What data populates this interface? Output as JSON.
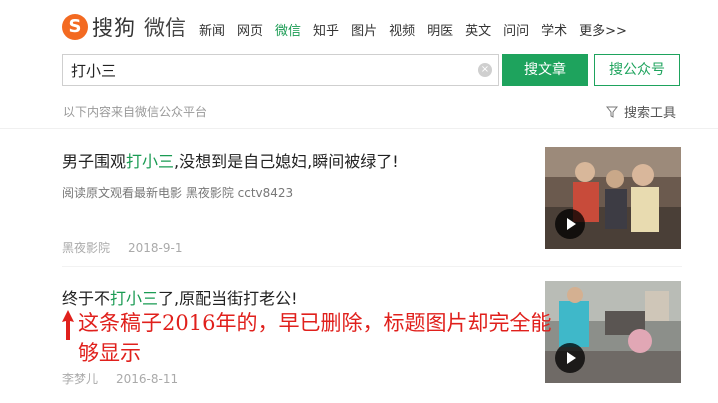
{
  "header": {
    "logo_mark": "S",
    "logo_text": "搜狗",
    "logo_sub": "微信",
    "nav": [
      {
        "label": "新闻",
        "active": false
      },
      {
        "label": "网页",
        "active": false
      },
      {
        "label": "微信",
        "active": true
      },
      {
        "label": "知乎",
        "active": false
      },
      {
        "label": "图片",
        "active": false
      },
      {
        "label": "视频",
        "active": false
      },
      {
        "label": "明医",
        "active": false
      },
      {
        "label": "英文",
        "active": false
      },
      {
        "label": "问问",
        "active": false
      },
      {
        "label": "学术",
        "active": false
      },
      {
        "label": "更多>>",
        "active": false
      }
    ]
  },
  "search": {
    "value": "打小三",
    "clear_icon": "×",
    "search_button": "搜文章",
    "search_account_button": "搜公众号"
  },
  "source_note": "以下内容来自微信公众平台",
  "tools_label": "搜索工具",
  "results": [
    {
      "title_prefix": "男子围观",
      "title_highlight": "打小三",
      "title_suffix": ",没想到是自己媳妇,瞬间被绿了!",
      "description": "阅读原文观看最新电影 黑夜影院 cctv8423",
      "author": "黑夜影院",
      "date": "2018-9-1"
    },
    {
      "title_prefix": "终于不",
      "title_highlight": "打小三",
      "title_suffix": "了,原配当街打老公!",
      "author": "李梦儿",
      "date": "2016-8-11"
    }
  ],
  "annotation": {
    "line1": "这条稿子2016年的，早已删除，标题图片却完全能",
    "line2": "够显示"
  },
  "colors": {
    "brand_green": "#1ea35d",
    "highlight_green": "#1a9b53",
    "logo_orange": "#f36a21",
    "annotation_red": "#e0201c"
  }
}
